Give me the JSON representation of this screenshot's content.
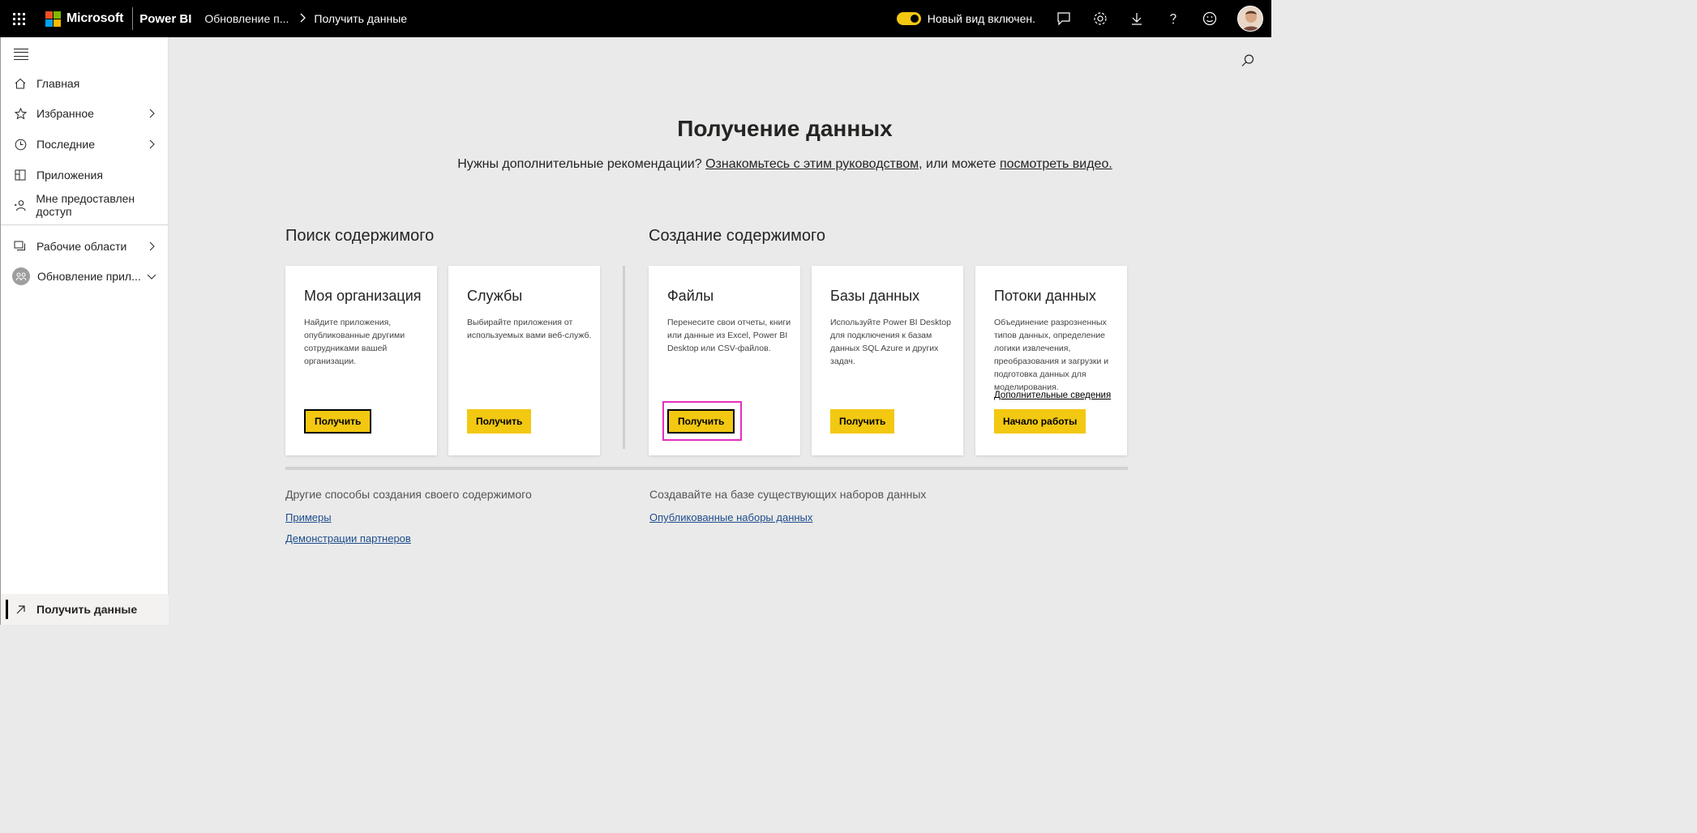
{
  "topbar": {
    "brand": "Microsoft",
    "product": "Power BI",
    "breadcrumb": [
      "Обновление п...",
      "Получить данные"
    ],
    "new_view_label": "Новый вид включен.",
    "accent_color": "#f2c811"
  },
  "sidebar": {
    "items": [
      {
        "label": "Главная",
        "icon": "home-icon"
      },
      {
        "label": "Избранное",
        "icon": "star-icon"
      },
      {
        "label": "Последние",
        "icon": "clock-icon"
      },
      {
        "label": "Приложения",
        "icon": "apps-icon"
      },
      {
        "label": "Мне предоставлен доступ",
        "icon": "shared-icon"
      },
      {
        "label": "Рабочие области",
        "icon": "workspaces-icon"
      },
      {
        "label": "Обновление прил...",
        "icon": "workspace-avatar-icon"
      }
    ],
    "bottom_item": "Получить данные"
  },
  "main": {
    "title": "Получение данных",
    "subtitle_prefix": "Нужны дополнительные рекомендации?",
    "guide_link": "Ознакомьтесь с этим руководством",
    "subtitle_mid": ", или можете",
    "video_link": "посмотреть видео.",
    "discover_title": "Поиск содержимого",
    "create_title": "Создание содержимого",
    "cards": [
      {
        "title": "Моя организация",
        "desc": "Найдите приложения, опубликованные другими сотрудниками вашей организации.",
        "button": "Получить"
      },
      {
        "title": "Службы",
        "desc": "Выбирайте приложения от используемых вами веб-служб.",
        "button": "Получить"
      },
      {
        "title": "Файлы",
        "desc": "Перенесите свои отчеты, книги или данные из Excel, Power BI Desktop или CSV-файлов.",
        "button": "Получить"
      },
      {
        "title": "Базы данных",
        "desc": "Используйте Power BI Desktop для подключения к базам данных SQL Azure и других задач.",
        "button": "Получить"
      },
      {
        "title": "Потоки данных",
        "desc": "Объединение разрозненных типов данных, определение логики извлечения, преобразования и загрузки и подготовка данных для моделирования.",
        "link": "Дополнительные сведения",
        "button": "Начало работы"
      }
    ],
    "other_title": "Другие способы создания своего содержимого",
    "other_links": [
      "Примеры",
      "Демонстрации партнеров"
    ],
    "existing_title": "Создавайте на базе существующих наборов данных",
    "existing_link": "Опубликованные наборы данных"
  }
}
